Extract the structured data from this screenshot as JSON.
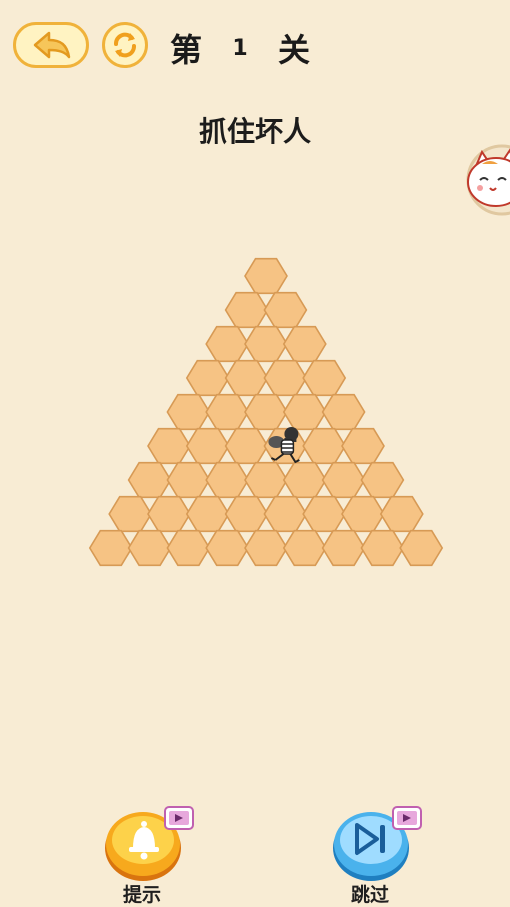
{
  "header": {
    "level_prefix": "第",
    "level_number": "1",
    "level_suffix": "关",
    "back_icon": "back-arrow-icon",
    "restart_icon": "restart-icon"
  },
  "objective": "抓住坏人",
  "board": {
    "shape": "triangle-pyramid",
    "rows": 9,
    "cell_counts": [
      1,
      2,
      3,
      4,
      5,
      6,
      7,
      8,
      9
    ],
    "thief_position": {
      "row": 5,
      "col": 3
    },
    "tile_color": "#f6c384",
    "tile_border": "#d79a55"
  },
  "footer": {
    "hint_label": "提示",
    "skip_label": "跳过",
    "hint_icon": "bell-icon",
    "skip_icon": "skip-forward-icon",
    "video_icon": "video-ad-icon"
  },
  "colors": {
    "background": "#f8ecd4",
    "accent_yellow": "#f0b23a",
    "hint_orange": "#f4a21e",
    "skip_blue": "#4ab2ec"
  }
}
